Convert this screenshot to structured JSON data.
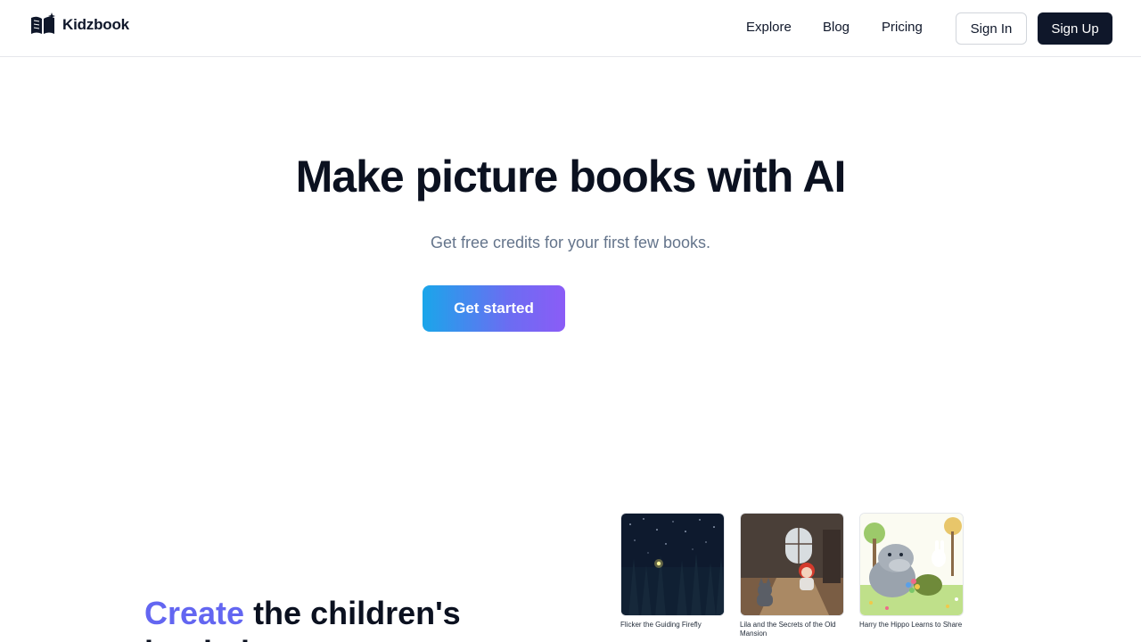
{
  "nav": {
    "brand": "Kidzbook",
    "links": [
      {
        "label": "Explore"
      },
      {
        "label": "Blog"
      },
      {
        "label": "Pricing"
      }
    ],
    "sign_in": "Sign In",
    "sign_up": "Sign Up"
  },
  "hero": {
    "title": "Make picture books with AI",
    "subtitle": "Get free credits for your first few books.",
    "cta": "Get started"
  },
  "section2": {
    "title_accent": "Create",
    "title_rest": " the children's",
    "title_line2": "book that you want"
  },
  "books": [
    {
      "title": "Flicker the Guiding Firefly"
    },
    {
      "title": "Lila and the Secrets of the Old Mansion"
    },
    {
      "title": "Harry the Hippo Learns to Share"
    }
  ],
  "colors": {
    "brand_dark": "#0f172a",
    "accent": "#6366f1",
    "cta_gradient_start": "#1aa6ea",
    "cta_gradient_end": "#8b5cf6"
  }
}
